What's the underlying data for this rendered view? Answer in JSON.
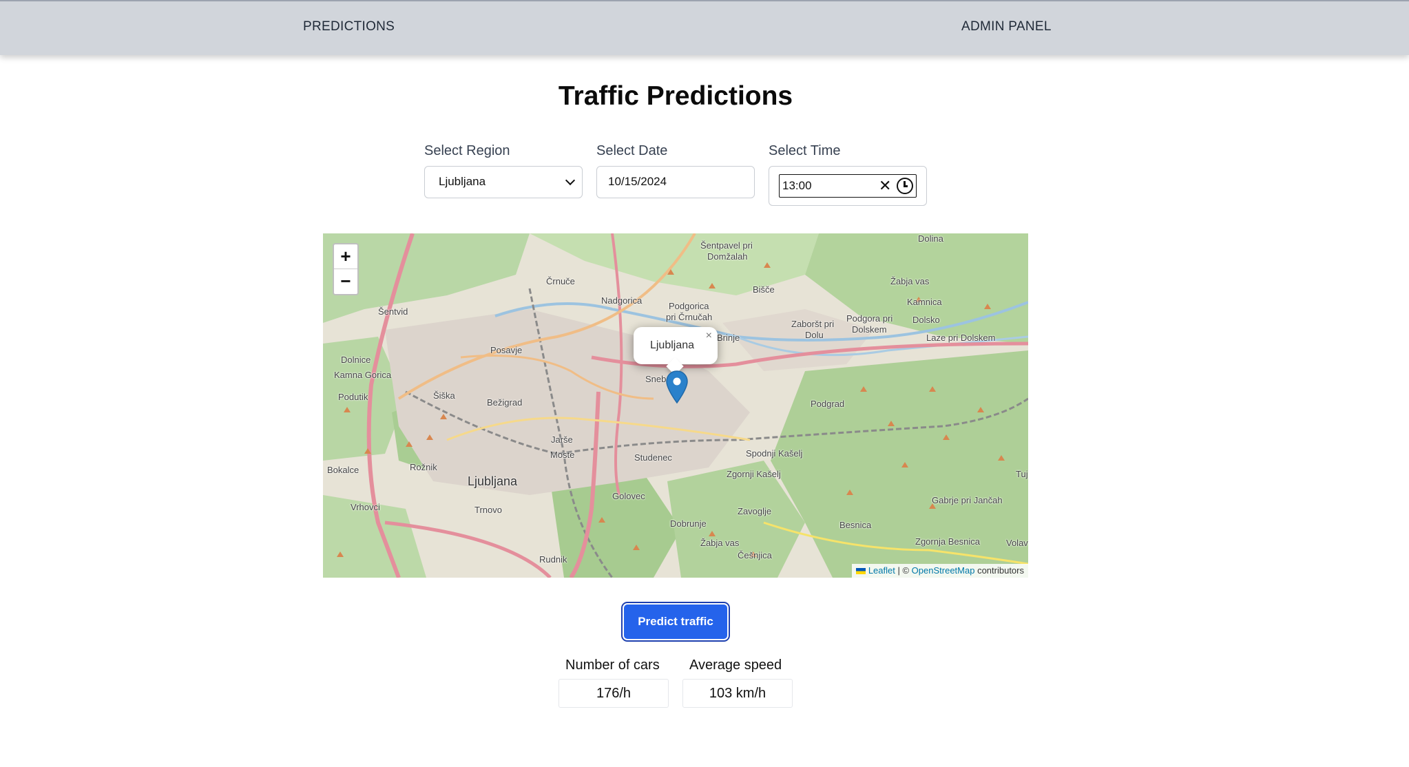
{
  "navbar": {
    "predictions_label": "PREDICTIONS",
    "admin_label": "ADMIN PANEL"
  },
  "page": {
    "title": "Traffic Predictions"
  },
  "form": {
    "region_label": "Select Region",
    "region_value": "Ljubljana",
    "date_label": "Select Date",
    "date_value": "10/15/2024",
    "time_label": "Select Time",
    "time_value": "13:00",
    "time_clear_icon": "close-icon",
    "time_clock_icon": "clock-icon"
  },
  "map": {
    "zoom_in_label": "+",
    "zoom_out_label": "−",
    "popup_text": "Ljubljana",
    "popup_close_label": "×",
    "attribution": {
      "leaflet": "Leaflet",
      "separator": " | © ",
      "osm": "OpenStreetMap",
      "contributors": " contributors"
    },
    "places": {
      "ljubljana": "Ljubljana",
      "bezigrad": "Bežigrad",
      "siska": "Šiška",
      "moste": "Moste",
      "jarse": "Jarše",
      "studenec": "Studenec",
      "posavje": "Posavje",
      "crnuce": "Črnuče",
      "nadgorica": "Nadgorica",
      "podgorica": "Podgorica",
      "pri_crnucah": "pri Črnučah",
      "sentpavel": "Šentpavel pri",
      "domzalah": "Domžalah",
      "dolina": "Dolina",
      "zabja_vas_top": "Žabja vas",
      "kamnica": "Kamnica",
      "bisce": "Bišče",
      "zaborst": "Zaboršt pri",
      "dolu": "Dolu",
      "podgora": "Podgora pri",
      "dolskem": "Dolskem",
      "dolsko": "Dolsko",
      "laze": "Laze pri Dolskem",
      "brinje": "Brinje",
      "sentvid": "Šentvid",
      "dolnice": "Dolnice",
      "kamna_gorica": "Kamna Gorica",
      "podutik": "Podutik",
      "bokalce": "Bokalce",
      "roznik": "Rožnik",
      "vrhovci": "Vrhovci",
      "trnovo": "Trnovo",
      "golovec": "Golovec",
      "dobrunje": "Dobrunje",
      "zabja_vas": "Žabja vas",
      "cesnjica": "Češnjica",
      "zavoglje": "Zavoglje",
      "spodnji_kaselj": "Spodnji Kašelj",
      "zgornji_kaselj": "Zgornji Kašelj",
      "podgrad": "Podgrad",
      "besnica": "Besnica",
      "gabrje": "Gabrje pri Jančah",
      "zgornja_besnica": "Zgornja Besnica",
      "rudnik": "Rudnik",
      "sneb": "Sneb",
      "tuj": "Tuj",
      "volav": "Volav"
    }
  },
  "predict_button": {
    "label": "Predict traffic"
  },
  "results": {
    "cars_label": "Number of cars",
    "cars_value": "176/h",
    "speed_label": "Average speed",
    "speed_value": "103 km/h"
  },
  "colors": {
    "navbar_bg": "#d1d5db",
    "primary_button": "#2563eb",
    "marker": "#2a81cb",
    "map_green": "#aed1a0",
    "map_urban": "#d9d0c9"
  }
}
